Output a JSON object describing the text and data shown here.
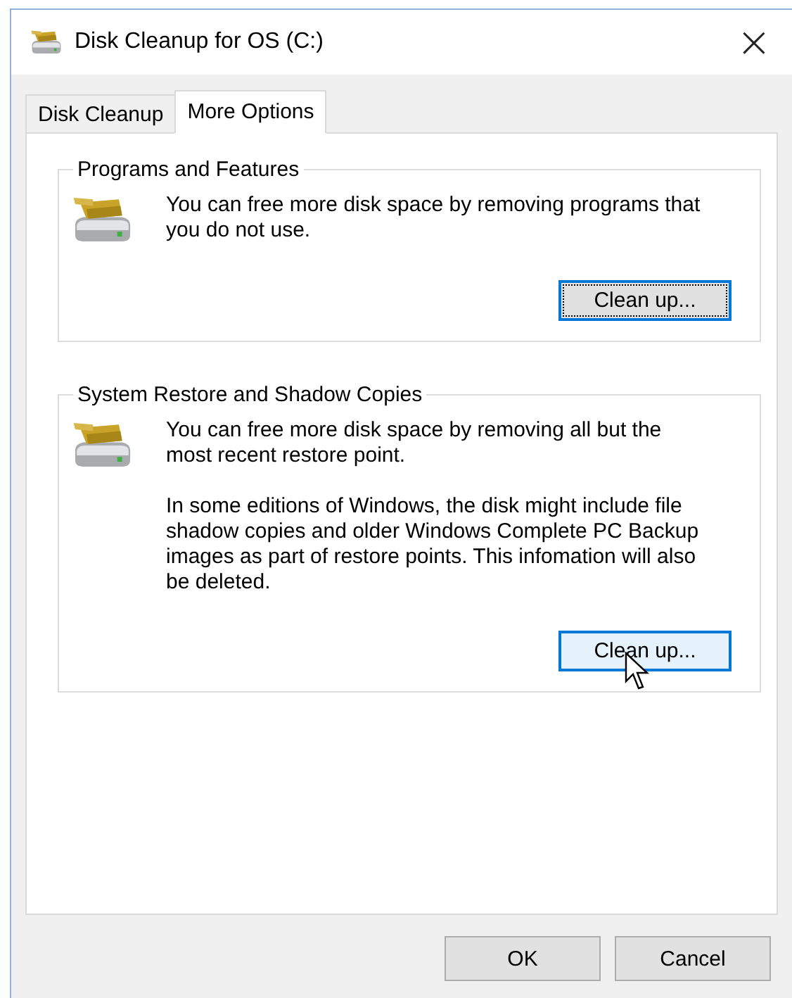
{
  "window": {
    "title": "Disk Cleanup for OS (C:)",
    "close": "×"
  },
  "tabs": [
    {
      "label": "Disk Cleanup",
      "selected": false
    },
    {
      "label": "More Options",
      "selected": true
    }
  ],
  "groups": [
    {
      "title": "Programs and Features",
      "paragraphs": [
        "You can free more disk space by removing programs that you do not use."
      ],
      "button": {
        "label": "Clean up...",
        "focused": true,
        "hovered": false
      }
    },
    {
      "title": "System Restore and Shadow Copies",
      "paragraphs": [
        "You can free more disk space by removing all but the most recent restore point.",
        "In some editions of Windows, the disk might include file shadow copies and older Windows Complete PC Backup images as part of restore points. This infomation will also be deleted."
      ],
      "button": {
        "label": "Clean up...",
        "focused": false,
        "hovered": true
      }
    }
  ],
  "buttons": [
    {
      "label": "OK"
    },
    {
      "label": "Cancel"
    }
  ]
}
